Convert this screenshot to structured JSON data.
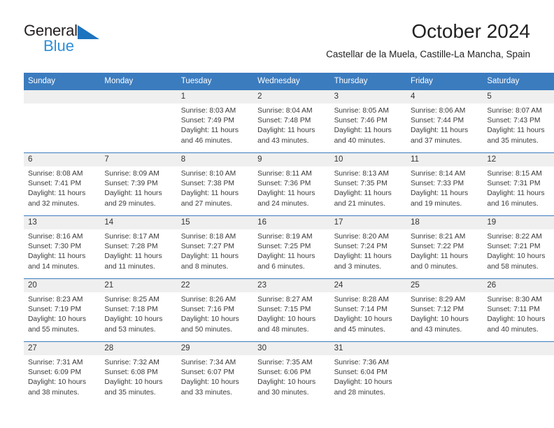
{
  "logo": {
    "word1": "General",
    "word2": "Blue",
    "triangle_color": "#1e73be",
    "word2_color": "#2f8fd8"
  },
  "header": {
    "title": "October 2024",
    "subtitle": "Castellar de la Muela, Castille-La Mancha, Spain"
  },
  "colors": {
    "header_bar": "#3b7cbf",
    "daynum_band": "#efefef",
    "week_separator": "#3b7cbf",
    "text": "#3a3a3a"
  },
  "weekday_headers": [
    "Sunday",
    "Monday",
    "Tuesday",
    "Wednesday",
    "Thursday",
    "Friday",
    "Saturday"
  ],
  "labels": {
    "sunrise_prefix": "Sunrise:",
    "sunset_prefix": "Sunset:",
    "daylight_prefix": "Daylight:"
  },
  "weeks": [
    [
      {
        "day": "",
        "empty": true
      },
      {
        "day": "",
        "empty": true
      },
      {
        "day": "1",
        "sunrise": "Sunrise: 8:03 AM",
        "sunset": "Sunset: 7:49 PM",
        "daylight": "Daylight: 11 hours and 46 minutes."
      },
      {
        "day": "2",
        "sunrise": "Sunrise: 8:04 AM",
        "sunset": "Sunset: 7:48 PM",
        "daylight": "Daylight: 11 hours and 43 minutes."
      },
      {
        "day": "3",
        "sunrise": "Sunrise: 8:05 AM",
        "sunset": "Sunset: 7:46 PM",
        "daylight": "Daylight: 11 hours and 40 minutes."
      },
      {
        "day": "4",
        "sunrise": "Sunrise: 8:06 AM",
        "sunset": "Sunset: 7:44 PM",
        "daylight": "Daylight: 11 hours and 37 minutes."
      },
      {
        "day": "5",
        "sunrise": "Sunrise: 8:07 AM",
        "sunset": "Sunset: 7:43 PM",
        "daylight": "Daylight: 11 hours and 35 minutes."
      }
    ],
    [
      {
        "day": "6",
        "sunrise": "Sunrise: 8:08 AM",
        "sunset": "Sunset: 7:41 PM",
        "daylight": "Daylight: 11 hours and 32 minutes."
      },
      {
        "day": "7",
        "sunrise": "Sunrise: 8:09 AM",
        "sunset": "Sunset: 7:39 PM",
        "daylight": "Daylight: 11 hours and 29 minutes."
      },
      {
        "day": "8",
        "sunrise": "Sunrise: 8:10 AM",
        "sunset": "Sunset: 7:38 PM",
        "daylight": "Daylight: 11 hours and 27 minutes."
      },
      {
        "day": "9",
        "sunrise": "Sunrise: 8:11 AM",
        "sunset": "Sunset: 7:36 PM",
        "daylight": "Daylight: 11 hours and 24 minutes."
      },
      {
        "day": "10",
        "sunrise": "Sunrise: 8:13 AM",
        "sunset": "Sunset: 7:35 PM",
        "daylight": "Daylight: 11 hours and 21 minutes."
      },
      {
        "day": "11",
        "sunrise": "Sunrise: 8:14 AM",
        "sunset": "Sunset: 7:33 PM",
        "daylight": "Daylight: 11 hours and 19 minutes."
      },
      {
        "day": "12",
        "sunrise": "Sunrise: 8:15 AM",
        "sunset": "Sunset: 7:31 PM",
        "daylight": "Daylight: 11 hours and 16 minutes."
      }
    ],
    [
      {
        "day": "13",
        "sunrise": "Sunrise: 8:16 AM",
        "sunset": "Sunset: 7:30 PM",
        "daylight": "Daylight: 11 hours and 14 minutes."
      },
      {
        "day": "14",
        "sunrise": "Sunrise: 8:17 AM",
        "sunset": "Sunset: 7:28 PM",
        "daylight": "Daylight: 11 hours and 11 minutes."
      },
      {
        "day": "15",
        "sunrise": "Sunrise: 8:18 AM",
        "sunset": "Sunset: 7:27 PM",
        "daylight": "Daylight: 11 hours and 8 minutes."
      },
      {
        "day": "16",
        "sunrise": "Sunrise: 8:19 AM",
        "sunset": "Sunset: 7:25 PM",
        "daylight": "Daylight: 11 hours and 6 minutes."
      },
      {
        "day": "17",
        "sunrise": "Sunrise: 8:20 AM",
        "sunset": "Sunset: 7:24 PM",
        "daylight": "Daylight: 11 hours and 3 minutes."
      },
      {
        "day": "18",
        "sunrise": "Sunrise: 8:21 AM",
        "sunset": "Sunset: 7:22 PM",
        "daylight": "Daylight: 11 hours and 0 minutes."
      },
      {
        "day": "19",
        "sunrise": "Sunrise: 8:22 AM",
        "sunset": "Sunset: 7:21 PM",
        "daylight": "Daylight: 10 hours and 58 minutes."
      }
    ],
    [
      {
        "day": "20",
        "sunrise": "Sunrise: 8:23 AM",
        "sunset": "Sunset: 7:19 PM",
        "daylight": "Daylight: 10 hours and 55 minutes."
      },
      {
        "day": "21",
        "sunrise": "Sunrise: 8:25 AM",
        "sunset": "Sunset: 7:18 PM",
        "daylight": "Daylight: 10 hours and 53 minutes."
      },
      {
        "day": "22",
        "sunrise": "Sunrise: 8:26 AM",
        "sunset": "Sunset: 7:16 PM",
        "daylight": "Daylight: 10 hours and 50 minutes."
      },
      {
        "day": "23",
        "sunrise": "Sunrise: 8:27 AM",
        "sunset": "Sunset: 7:15 PM",
        "daylight": "Daylight: 10 hours and 48 minutes."
      },
      {
        "day": "24",
        "sunrise": "Sunrise: 8:28 AM",
        "sunset": "Sunset: 7:14 PM",
        "daylight": "Daylight: 10 hours and 45 minutes."
      },
      {
        "day": "25",
        "sunrise": "Sunrise: 8:29 AM",
        "sunset": "Sunset: 7:12 PM",
        "daylight": "Daylight: 10 hours and 43 minutes."
      },
      {
        "day": "26",
        "sunrise": "Sunrise: 8:30 AM",
        "sunset": "Sunset: 7:11 PM",
        "daylight": "Daylight: 10 hours and 40 minutes."
      }
    ],
    [
      {
        "day": "27",
        "sunrise": "Sunrise: 7:31 AM",
        "sunset": "Sunset: 6:09 PM",
        "daylight": "Daylight: 10 hours and 38 minutes."
      },
      {
        "day": "28",
        "sunrise": "Sunrise: 7:32 AM",
        "sunset": "Sunset: 6:08 PM",
        "daylight": "Daylight: 10 hours and 35 minutes."
      },
      {
        "day": "29",
        "sunrise": "Sunrise: 7:34 AM",
        "sunset": "Sunset: 6:07 PM",
        "daylight": "Daylight: 10 hours and 33 minutes."
      },
      {
        "day": "30",
        "sunrise": "Sunrise: 7:35 AM",
        "sunset": "Sunset: 6:06 PM",
        "daylight": "Daylight: 10 hours and 30 minutes."
      },
      {
        "day": "31",
        "sunrise": "Sunrise: 7:36 AM",
        "sunset": "Sunset: 6:04 PM",
        "daylight": "Daylight: 10 hours and 28 minutes."
      },
      {
        "day": "",
        "empty": true
      },
      {
        "day": "",
        "empty": true
      }
    ]
  ]
}
